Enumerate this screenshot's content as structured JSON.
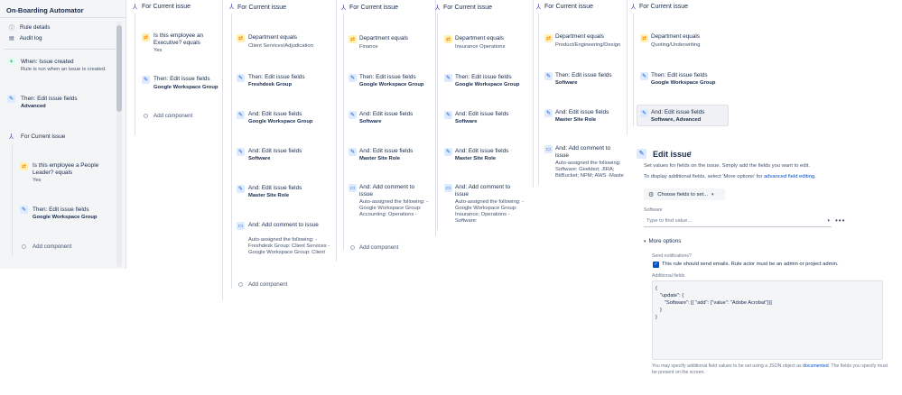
{
  "sidebar": {
    "title": "On-Boarding Automator",
    "rule_details": "Rule details",
    "audit_log": "Audit log",
    "trigger_title": "When: Issue created",
    "trigger_sub": "Rule is run when an issue is created.",
    "action1_title": "Then: Edit issue fields",
    "action1_sub": "Advanced",
    "branch_title": "For Current issue",
    "cond_title": "Is this employee a People Leader? equals",
    "cond_value": "Yes",
    "action2_title": "Then: Edit issue fields",
    "action2_sub": "Google Workspace Group",
    "add_component": "Add component"
  },
  "col1": {
    "header": "For Current issue",
    "cond_title": "Is this employee an Executive? equals",
    "cond_value": "Yes",
    "a1_title": "Then: Edit issue fields",
    "a1_sub": "Google Workspace Group",
    "add": "Add component"
  },
  "col2": {
    "header": "For Current issue",
    "cond_title": "Department equals",
    "cond_value": "Client Services/Adjudication",
    "a1_title": "Then: Edit issue fields",
    "a1_sub": "Freshdesk Group",
    "a2_title": "And: Edit issue fields",
    "a2_sub": "Google Workspace Group",
    "a3_title": "And: Edit issue fields",
    "a3_sub": "Software",
    "a4_title": "And: Edit issue fields",
    "a4_sub": "Master Site Role",
    "c_title": "And: Add comment to issue",
    "c_body": "Auto-assigned the following: - Freshdesk Group: Client Services - Google Workspace Group: Client",
    "add": "Add component"
  },
  "col3": {
    "header": "For Current issue",
    "cond_title": "Department equals",
    "cond_value": "Finance",
    "a1_title": "Then: Edit issue fields",
    "a1_sub": "Google Workspace Group",
    "a2_title": "And: Edit issue fields",
    "a2_sub": "Software",
    "a3_title": "And: Edit issue fields",
    "a3_sub": "Master Site Role",
    "c_title": "And: Add comment to issue",
    "c_body": "Auto-assigned the following: - Google Workspace Group: Accounting: Operations -",
    "add": "Add component"
  },
  "col4": {
    "header": "For Current issue",
    "cond_title": "Department equals",
    "cond_value": "Insurance Operations",
    "a1_title": "Then: Edit issue fields",
    "a1_sub": "Google Workspace Group",
    "a2_title": "And: Edit issue fields",
    "a2_sub": "Software",
    "a3_title": "And: Edit issue fields",
    "a3_sub": "Master Site Role",
    "c_title": "And: Add comment to issue",
    "c_body": "Auto-assigned the following: - Google Workspace Group: Insurance; Operations -Software:"
  },
  "col5": {
    "header": "For Current issue",
    "cond_title": "Department equals",
    "cond_value": "Product/Engineering/Design",
    "a1_title": "Then: Edit issue fields",
    "a1_sub": "Software",
    "a2_title": "And: Edit issue fields",
    "a2_sub": "Master Site Role",
    "c_title": "And: Add comment to issue",
    "c_body": "Auto-assigned the following: Software: Geekbot; JIRA; BitBucket; NPM; AWS -Maste"
  },
  "col6": {
    "header": "For Current issue",
    "cond_title": "Department equals",
    "cond_value": "Quoting/Underwriting",
    "a1_title": "Then: Edit issue fields",
    "a1_sub": "Google Workspace Group",
    "a2_title": "And: Edit issue fields",
    "a2_sub": "Software, Advanced"
  },
  "panel": {
    "title": "Edit issue",
    "desc1": "Set values for fields on the issue. Simply add the fields you want to edit.",
    "desc2": "To display additional fields, select 'More options' for",
    "desc2_link": "advanced field editing.",
    "choose_btn": "Choose fields to set...",
    "software_label": "Software",
    "software_placeholder": "Type to find value...",
    "more_options": "More options",
    "send_notif_label": "Send notifications?",
    "send_notif_text": "This rule should send emails. Rule actor must be an admin or project admin.",
    "additional_label": "Additional fields",
    "json_l1": "{",
    "json_l2": "\"update\": {",
    "json_l3": "\"Software\": [{ \"add\": {\"value\": \"Adobe Acrobat\"}}]",
    "json_l4": "}",
    "json_l5": "}",
    "footer_a": "You may specify additional field values to be set using a JSON object as",
    "footer_link": "documented",
    "footer_b": ". The fields you specify must be present on the screen."
  },
  "colors": {
    "branch": "#6554c0",
    "condition": "#ff8b00",
    "action": "#0052cc",
    "trigger": "#36b37e",
    "link": "#0052cc"
  }
}
